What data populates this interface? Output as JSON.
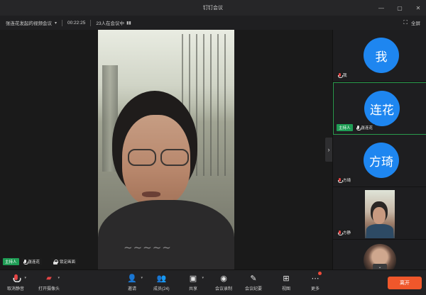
{
  "window": {
    "title": "钉钉会议",
    "controls": [
      "—",
      "▢",
      "✕"
    ]
  },
  "infobar": {
    "meeting_title": "张连花发起的视频会议",
    "elapsed": "00:22:25",
    "attendance": "23人在会议中",
    "fullscreen_label": "全屏"
  },
  "main_video": {
    "host_tag": "主持人",
    "speaker_name": "张连花",
    "lock_label": "锁定画面"
  },
  "participants": [
    {
      "avatar": "我",
      "name": "我",
      "muted": true
    },
    {
      "avatar": "连花",
      "name": "张连花",
      "host_tag": "主持人",
      "muted": false,
      "active": true
    },
    {
      "avatar": "方琦",
      "name": "方琦",
      "muted": true
    },
    {
      "name": "方静",
      "muted": true,
      "has_video": true
    },
    {
      "has_video": true
    }
  ],
  "toolbar": {
    "mute": "取消静音",
    "camera": "打开摄像头",
    "invite": "邀请",
    "members": "成员(24)",
    "share": "共享",
    "record": "会议录制",
    "minutes": "会议纪要",
    "view": "视图",
    "more": "更多",
    "leave": "离开"
  },
  "colors": {
    "accent_blue": "#1e86f0",
    "host_green": "#1f9d55",
    "leave_orange": "#f0572b"
  }
}
